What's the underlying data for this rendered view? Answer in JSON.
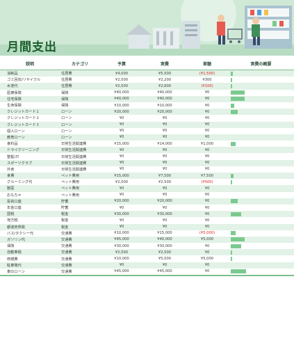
{
  "title": "月間支出",
  "headers": [
    "説明",
    "カテゴリ",
    "予算",
    "実費",
    "差額",
    "実費の概要"
  ],
  "rows": [
    {
      "desc": "消耗品",
      "cat": "住居費",
      "budget": "¥4,000",
      "actual": "¥5,500",
      "diff": "(¥1,500)",
      "neg": true,
      "ratio": 0.12
    },
    {
      "desc": "ゴミ回収/リサイクル",
      "cat": "住居費",
      "budget": "¥2,500",
      "actual": "¥2,200",
      "diff": "¥300",
      "neg": false,
      "ratio": 0.05
    },
    {
      "desc": "水道代",
      "cat": "住居費",
      "budget": "¥2,500",
      "actual": "¥2,600",
      "diff": "(¥100)",
      "neg": true,
      "ratio": 0.06
    },
    {
      "desc": "医療保険",
      "cat": "保険",
      "budget": "¥40,000",
      "actual": "¥40,000",
      "diff": "¥0",
      "neg": false,
      "ratio": 0.89
    },
    {
      "desc": "住宅保険",
      "cat": "保険",
      "budget": "¥40,000",
      "actual": "¥40,000",
      "diff": "¥0",
      "neg": false,
      "ratio": 0.89
    },
    {
      "desc": "生命保険",
      "cat": "保険",
      "budget": "¥10,000",
      "actual": "¥10,000",
      "diff": "¥0",
      "neg": false,
      "ratio": 0.22
    },
    {
      "desc": "クレジットカード１",
      "cat": "ローン",
      "budget": "¥20,000",
      "actual": "¥20,000",
      "diff": "¥0",
      "neg": false,
      "ratio": 0.44
    },
    {
      "desc": "クレジットカード２",
      "cat": "ローン",
      "budget": "¥0",
      "actual": "¥0",
      "diff": "¥0",
      "neg": false,
      "ratio": 0
    },
    {
      "desc": "クレジットカード３",
      "cat": "ローン",
      "budget": "¥0",
      "actual": "¥0",
      "diff": "¥0",
      "neg": false,
      "ratio": 0
    },
    {
      "desc": "個人ローン",
      "cat": "ローン",
      "budget": "¥0",
      "actual": "¥0",
      "diff": "¥0",
      "neg": false,
      "ratio": 0
    },
    {
      "desc": "教育ローン",
      "cat": "ローン",
      "budget": "¥0",
      "actual": "¥0",
      "diff": "¥0",
      "neg": false,
      "ratio": 0
    },
    {
      "desc": "食料品",
      "cat": "日常生活関連費",
      "budget": "¥15,000",
      "actual": "¥14,000",
      "diff": "¥1,000",
      "neg": false,
      "ratio": 0.31
    },
    {
      "desc": "ドライクリーニング",
      "cat": "日常生活関連費",
      "budget": "¥0",
      "actual": "¥0",
      "diff": "¥0",
      "neg": false,
      "ratio": 0
    },
    {
      "desc": "整髪/爪",
      "cat": "日常生活関連費",
      "budget": "¥0",
      "actual": "¥0",
      "diff": "¥0",
      "neg": false,
      "ratio": 0
    },
    {
      "desc": "スポーツクラブ",
      "cat": "日常生活関連費",
      "budget": "¥0",
      "actual": "¥0",
      "diff": "¥0",
      "neg": false,
      "ratio": 0
    },
    {
      "desc": "外食",
      "cat": "日常生活関連費",
      "budget": "¥0",
      "actual": "¥0",
      "diff": "¥0",
      "neg": false,
      "ratio": 0
    },
    {
      "desc": "食費",
      "cat": "ペット費用",
      "budget": "¥15,000",
      "actual": "¥7,500",
      "diff": "¥7,500",
      "neg": false,
      "ratio": 0.17
    },
    {
      "desc": "グルーミング代",
      "cat": "ペット費用",
      "budget": "¥2,000",
      "actual": "¥2,500",
      "diff": "(¥500)",
      "neg": true,
      "ratio": 0.06
    },
    {
      "desc": "獣医",
      "cat": "ペット費用",
      "budget": "¥0",
      "actual": "¥0",
      "diff": "¥0",
      "neg": false,
      "ratio": 0
    },
    {
      "desc": "おもちゃ",
      "cat": "ペット費用",
      "budget": "¥0",
      "actual": "¥0",
      "diff": "¥0",
      "neg": false,
      "ratio": 0
    },
    {
      "desc": "投資口座",
      "cat": "貯蓄",
      "budget": "¥20,000",
      "actual": "¥20,000",
      "diff": "¥0",
      "neg": false,
      "ratio": 0.44
    },
    {
      "desc": "年金口座",
      "cat": "貯蓄",
      "budget": "¥0",
      "actual": "¥0",
      "diff": "¥0",
      "neg": false,
      "ratio": 0
    },
    {
      "desc": "国税",
      "cat": "税金",
      "budget": "¥30,000",
      "actual": "¥30,000",
      "diff": "¥0",
      "neg": false,
      "ratio": 0.67
    },
    {
      "desc": "地方税",
      "cat": "税金",
      "budget": "¥0",
      "actual": "¥0",
      "diff": "¥0",
      "neg": false,
      "ratio": 0
    },
    {
      "desc": "都道府県税",
      "cat": "税金",
      "budget": "¥0",
      "actual": "¥0",
      "diff": "¥0",
      "neg": false,
      "ratio": 0
    },
    {
      "desc": "バス/タクシー代",
      "cat": "交通費",
      "budget": "¥10,000",
      "actual": "¥15,000",
      "diff": "(¥5,000)",
      "neg": true,
      "ratio": 0.33
    },
    {
      "desc": "ガソリン代",
      "cat": "交通費",
      "budget": "¥45,000",
      "actual": "¥40,000",
      "diff": "¥5,000",
      "neg": false,
      "ratio": 0.89
    },
    {
      "desc": "保険",
      "cat": "交通費",
      "budget": "¥30,000",
      "actual": "¥30,000",
      "diff": "¥0",
      "neg": false,
      "ratio": 0.67
    },
    {
      "desc": "自動車税",
      "cat": "交通費",
      "budget": "¥2,500",
      "actual": "¥2,500",
      "diff": "¥0",
      "neg": false,
      "ratio": 0.06
    },
    {
      "desc": "修繕費",
      "cat": "交通費",
      "budget": "¥10,000",
      "actual": "¥5,000",
      "diff": "¥5,000",
      "neg": false,
      "ratio": 0.11
    },
    {
      "desc": "駐車場代",
      "cat": "交通費",
      "budget": "¥0",
      "actual": "¥0",
      "diff": "¥0",
      "neg": false,
      "ratio": 0
    },
    {
      "desc": "車のローン",
      "cat": "交通費",
      "budget": "¥45,000",
      "actual": "¥45,000",
      "diff": "¥0",
      "neg": false,
      "ratio": 1.0
    }
  ],
  "colors": {
    "accent": "#7bc98f",
    "title": "#1b5e2c",
    "negative": "#d9251c",
    "stripe": "#e2f2e6"
  }
}
